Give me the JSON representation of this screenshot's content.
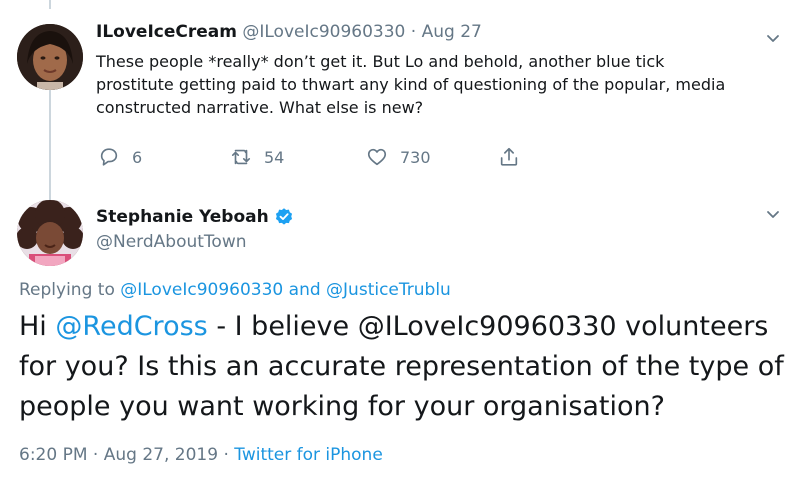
{
  "reply_tweet": {
    "display_name": "ILoveIceCream",
    "handle": "@ILoveIc90960330",
    "date": "Aug 27",
    "text": "These people *really* don’t get it. But Lo and behold, another blue tick prostitute getting paid to thwart any kind of questioning of the popular, media constructed narrative. What else is new?",
    "reply_count": "6",
    "retweet_count": "54",
    "like_count": "730"
  },
  "main_tweet": {
    "display_name": "Stephanie Yeboah",
    "handle": "@NerdAboutTown",
    "replying_prefix": "Replying to",
    "replying_user1": "@ILoveIc90960330",
    "replying_and": "and",
    "replying_user2": "@JusticeTrublu",
    "text_greeting": "Hi",
    "text_mention": "@RedCross",
    "text_rest": "- I believe @ILoveIc90960330 volunteers for you? Is this an accurate representation of the type of people you want working for your organisation?",
    "time": "6:20 PM",
    "date": "Aug 27, 2019",
    "source": "Twitter for iPhone",
    "separator": "·"
  },
  "colors": {
    "link": "#1b95e0",
    "muted": "#657786",
    "text": "#14171a",
    "thread_line": "#ccd6dd",
    "verified": "#1da1f2"
  },
  "icons": [
    "reply-icon",
    "retweet-icon",
    "like-icon",
    "share-icon",
    "chevron-down-icon",
    "verified-badge-icon"
  ]
}
